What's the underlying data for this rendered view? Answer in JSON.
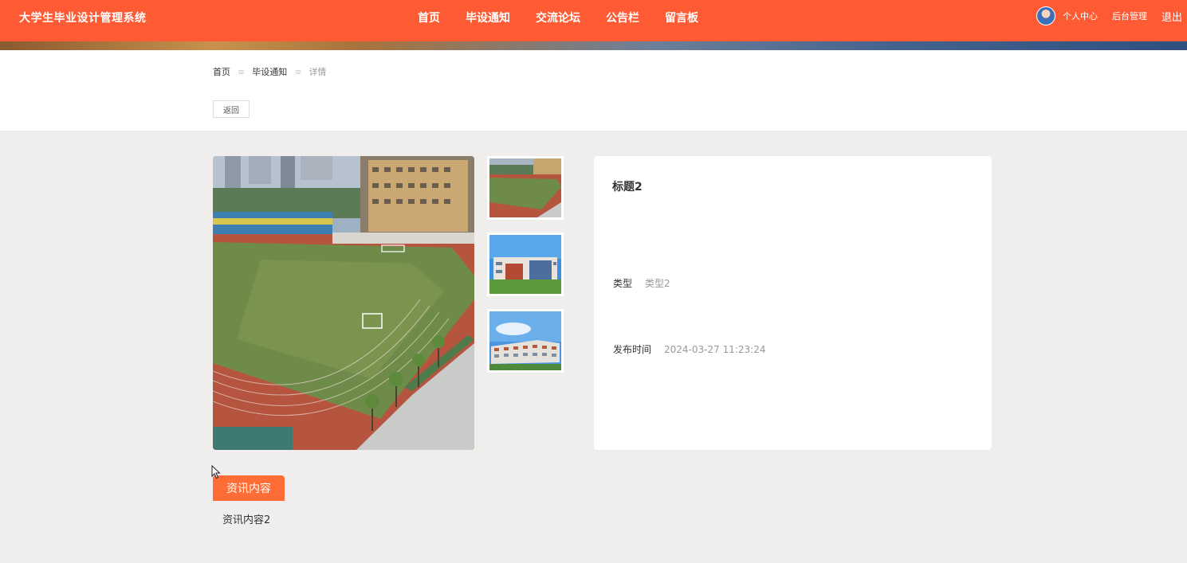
{
  "header": {
    "site_title": "大学生毕业设计管理系统",
    "nav": [
      "首页",
      "毕设通知",
      "交流论坛",
      "公告栏",
      "留言板"
    ],
    "user_center": "个人中心",
    "admin": "后台管理",
    "logout": "退出"
  },
  "breadcrumb": {
    "home": "首页",
    "section": "毕设通知",
    "separator": "≡",
    "current": "详情"
  },
  "back_label": "返回",
  "detail": {
    "title": "标题2",
    "type_label": "类型",
    "type_value": "类型2",
    "time_label": "发布时间",
    "time_value": "2024-03-27 11:23:24"
  },
  "content": {
    "tab_label": "资讯内容",
    "text": "资讯内容2"
  },
  "colors": {
    "primary": "#fe5b34",
    "tab": "#fe6d35",
    "page_bg": "#f0eeec"
  },
  "icons": [
    "avatar",
    "cursor-icon"
  ]
}
